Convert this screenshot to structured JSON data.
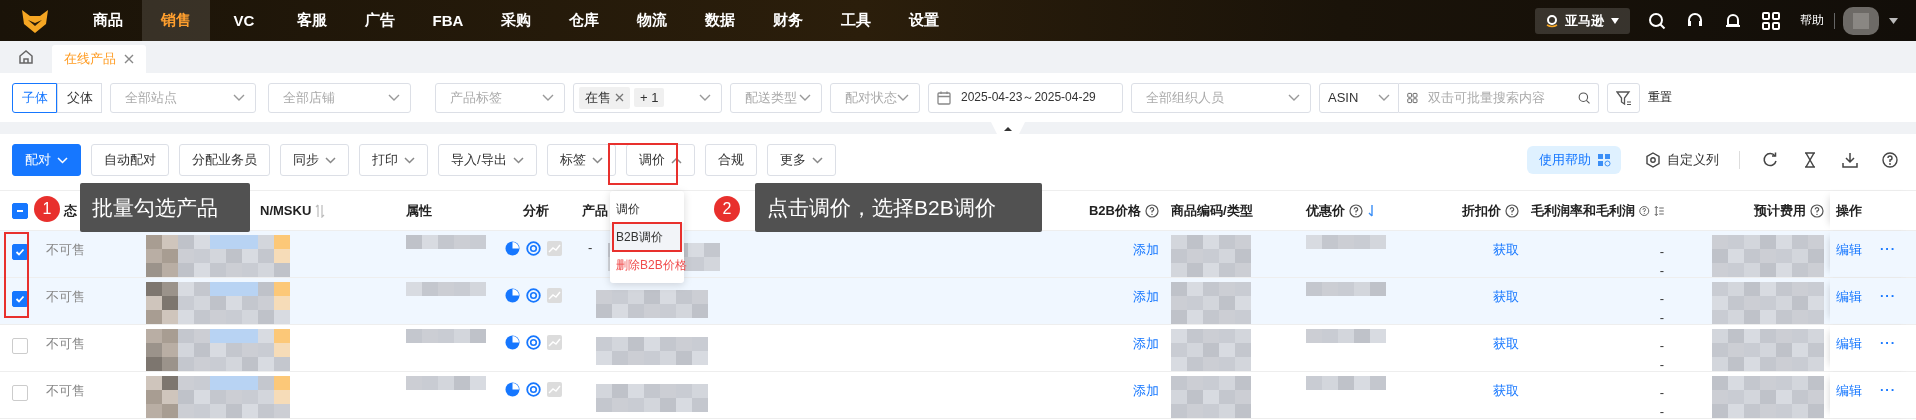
{
  "nav": {
    "items": [
      {
        "label": "商品",
        "selected": false
      },
      {
        "label": "销售",
        "selected": true
      },
      {
        "label": "VC",
        "selected": false
      },
      {
        "label": "客服",
        "selected": false
      },
      {
        "label": "广告",
        "selected": false
      },
      {
        "label": "FBA",
        "selected": false
      },
      {
        "label": "采购",
        "selected": false
      },
      {
        "label": "仓库",
        "selected": false
      },
      {
        "label": "物流",
        "selected": false
      },
      {
        "label": "数据",
        "selected": false
      },
      {
        "label": "财务",
        "selected": false
      },
      {
        "label": "工具",
        "selected": false
      },
      {
        "label": "设置",
        "selected": false
      }
    ],
    "store": "亚马逊",
    "help": "帮助"
  },
  "tabs": [
    {
      "label": "在线产品",
      "selected": true
    }
  ],
  "filters": {
    "variant": [
      {
        "label": "子体",
        "selected": true
      },
      {
        "label": "父体",
        "selected": false
      }
    ],
    "selects": [
      {
        "kind": "select",
        "placeholder": "全部站点"
      },
      {
        "kind": "select",
        "placeholder": "全部店铺"
      },
      {
        "kind": "select",
        "placeholder": "产品标签"
      },
      {
        "kind": "tags",
        "tags": [
          "在售"
        ],
        "more": "+ 1"
      },
      {
        "kind": "select",
        "placeholder": "配送类型"
      },
      {
        "kind": "select",
        "placeholder": "配对状态"
      },
      {
        "kind": "date",
        "value": "2025-04-23～2025-04-29"
      },
      {
        "kind": "select",
        "placeholder": "全部组织人员"
      }
    ],
    "search": {
      "field": "ASIN",
      "placeholder": "双击可批量搜索内容"
    },
    "reset": "重置"
  },
  "toolbar": {
    "buttons": [
      {
        "label": "配对",
        "kind": "primary",
        "menu": true,
        "expanded": false
      },
      {
        "label": "自动配对",
        "kind": "plain",
        "menu": false
      },
      {
        "label": "分配业务员",
        "kind": "plain",
        "menu": false
      },
      {
        "label": "同步",
        "kind": "plain",
        "menu": true,
        "expanded": false
      },
      {
        "label": "打印",
        "kind": "plain",
        "menu": true,
        "expanded": false
      },
      {
        "label": "导入/导出",
        "kind": "plain",
        "menu": true,
        "expanded": false
      },
      {
        "label": "标签",
        "kind": "plain",
        "menu": true,
        "expanded": false
      },
      {
        "label": "调价",
        "kind": "plain",
        "menu": true,
        "expanded": true
      },
      {
        "label": "合规",
        "kind": "plain",
        "menu": false
      },
      {
        "label": "更多",
        "kind": "plain",
        "menu": true,
        "expanded": false
      }
    ],
    "help": "使用帮助",
    "columns": "自定义列"
  },
  "dropdown": {
    "items": [
      {
        "label": "调价",
        "selected": false,
        "kind": "normal"
      },
      {
        "label": "B2B调价",
        "selected": true,
        "kind": "normal"
      },
      {
        "label": "删除B2B价格",
        "selected": false,
        "kind": "danger"
      }
    ]
  },
  "table": {
    "indeterminate": true,
    "columns": [
      {
        "label": "态",
        "info": false,
        "kind": "plain"
      },
      {
        "label": "N/MSKU",
        "info": false,
        "kind": "sortable"
      },
      {
        "label": "属性",
        "info": false,
        "kind": "plain"
      },
      {
        "label": "分析",
        "info": false,
        "kind": "plain"
      },
      {
        "label": "产品",
        "info": false,
        "kind": "plain"
      },
      {
        "label": "B2B价格",
        "info": true,
        "kind": "plain"
      },
      {
        "label": "商品编码/类型",
        "info": false,
        "kind": "plain"
      },
      {
        "label": "优惠价",
        "info": true,
        "kind": "sorted"
      },
      {
        "label": "折扣价",
        "info": true,
        "kind": "plain"
      },
      {
        "label": "毛利润率和毛利润",
        "info": true,
        "kind": "sort_list"
      },
      {
        "label": "预计费用",
        "info": true,
        "kind": "plain"
      },
      {
        "label": "操作",
        "info": false,
        "kind": "plain"
      }
    ],
    "rows": [
      {
        "checked": true,
        "status": "不可售",
        "product": "-",
        "b2b": "添加",
        "discount": "获取",
        "profit": [
          "-",
          "-"
        ],
        "edit": "编辑",
        "more": "···"
      },
      {
        "checked": true,
        "status": "不可售",
        "b2b": "添加",
        "discount": "获取",
        "profit": [
          "-",
          "-"
        ],
        "edit": "编辑",
        "more": "···"
      },
      {
        "checked": false,
        "status": "不可售",
        "b2b": "添加",
        "discount": "获取",
        "profit": [
          "-",
          "-"
        ],
        "edit": "编辑",
        "more": "···"
      },
      {
        "checked": false,
        "status": "不可售",
        "b2b": "添加",
        "discount": "获取",
        "profit": [
          "-",
          "-"
        ],
        "edit": "编辑",
        "more": "···"
      }
    ]
  },
  "steps": [
    {
      "number": "1",
      "text": "批量勾选产品"
    },
    {
      "number": "2",
      "text": "点击调价，选择B2B调价"
    }
  ]
}
